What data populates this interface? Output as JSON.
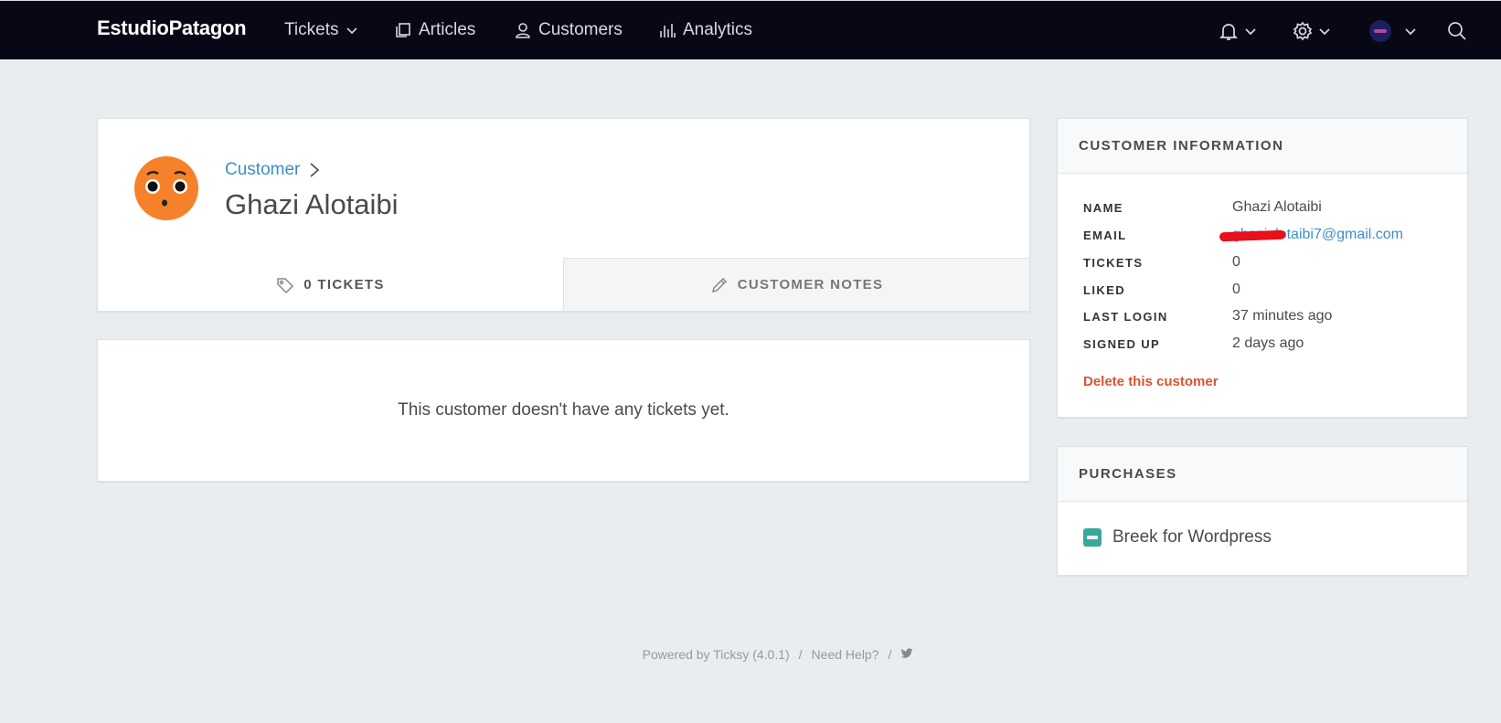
{
  "nav": {
    "brand": "EstudioPatagon",
    "items": [
      {
        "label": "Tickets",
        "icon": "chevron-down-icon"
      },
      {
        "label": "Articles",
        "icon": "articles-icon"
      },
      {
        "label": "Customers",
        "icon": "user-icon"
      },
      {
        "label": "Analytics",
        "icon": "bar-chart-icon"
      }
    ],
    "right_icons": [
      "bell-icon",
      "gear-icon",
      "avatar",
      "search-icon"
    ]
  },
  "profile": {
    "breadcrumb": "Customer",
    "name": "Ghazi Alotaibi",
    "tabs": [
      {
        "label": "0 TICKETS",
        "icon": "tag-icon",
        "active": true
      },
      {
        "label": "CUSTOMER NOTES",
        "icon": "pencil-icon",
        "active": false
      }
    ]
  },
  "tickets": {
    "empty_message": "This customer doesn't have any tickets yet."
  },
  "customer_info": {
    "title": "CUSTOMER INFORMATION",
    "rows": [
      {
        "label": "NAME",
        "value": "Ghazi Alotaibi"
      },
      {
        "label": "EMAIL",
        "value": "ghazialotaibi7@gmail.com"
      },
      {
        "label": "TICKETS",
        "value": "0"
      },
      {
        "label": "LIKED",
        "value": "0"
      },
      {
        "label": "LAST LOGIN",
        "value": "37 minutes ago"
      },
      {
        "label": "SIGNED UP",
        "value": "2 days ago"
      }
    ],
    "delete_label": "Delete this customer"
  },
  "purchases": {
    "title": "PURCHASES",
    "items": [
      {
        "label": "Breek for Wordpress"
      }
    ]
  },
  "footer": {
    "powered": "Powered by Ticksy (4.0.1)",
    "sep1": "/",
    "help": "Need Help?",
    "sep2": "/"
  },
  "colors": {
    "nav_bg": "#070716",
    "link": "#3e8ec9",
    "danger": "#d8542f",
    "avatar": "#f5822a"
  }
}
